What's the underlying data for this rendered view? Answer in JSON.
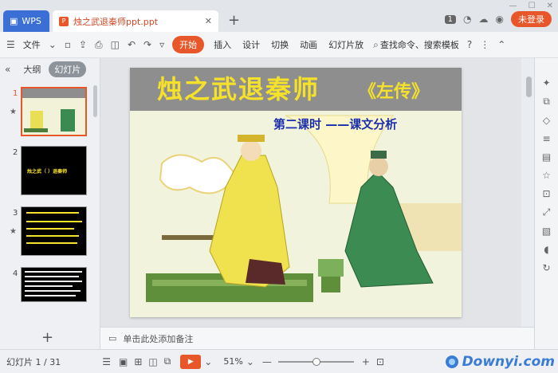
{
  "app": {
    "wps_tab": "WPS",
    "doc_tab": "烛之武退秦师ppt.ppt",
    "badge": "1",
    "login": "未登录"
  },
  "toolbar": {
    "file": "文件",
    "start": "开始",
    "menus": [
      "插入",
      "设计",
      "切换",
      "动画",
      "幻灯片放"
    ],
    "search": "查找命令、搜索模板",
    "help": "?"
  },
  "left_panel": {
    "outline_tab": "大纲",
    "slides_tab": "幻灯片",
    "slide_numbers": [
      "1",
      "2",
      "3",
      "4"
    ],
    "thumb2_text": "烛之武（    ）退秦师"
  },
  "slide": {
    "title": "烛之武退秦师",
    "source": "《左传》",
    "subtitle": "第二课时  ——课文分析"
  },
  "notes": {
    "placeholder": "单击此处添加备注"
  },
  "status": {
    "slide_counter": "幻灯片 1 / 31",
    "zoom": "51%"
  },
  "watermark": {
    "text": "Downyi.com"
  },
  "colors": {
    "accent": "#e8572a",
    "wps_blue": "#3b6fd6",
    "title_yellow": "#f6e12a",
    "subtitle_blue": "#1a2fb0"
  }
}
